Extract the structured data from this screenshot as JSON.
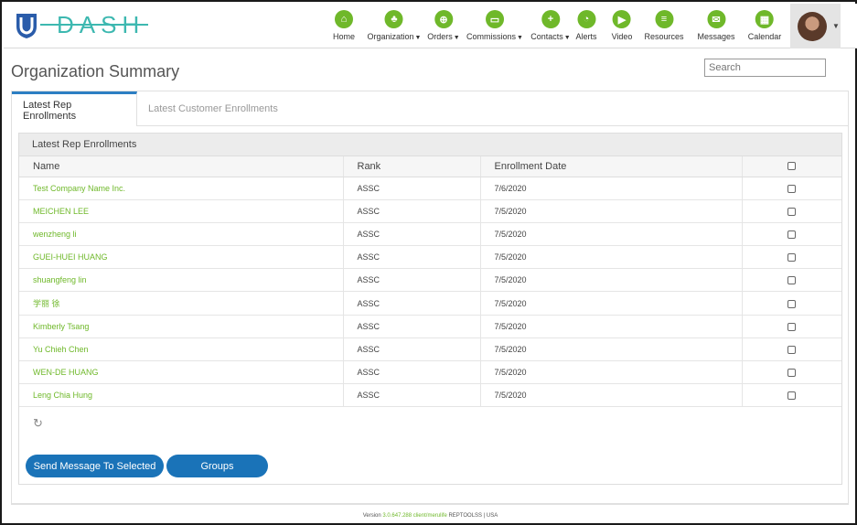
{
  "brand": {
    "logo_text": "DASH"
  },
  "nav": [
    {
      "label": "Home",
      "icon": "home-icon",
      "dropdown": false
    },
    {
      "label": "Organization",
      "icon": "organization-icon",
      "dropdown": true
    },
    {
      "label": "Orders",
      "icon": "cart-icon",
      "dropdown": true
    },
    {
      "label": "Commissions",
      "icon": "wallet-icon",
      "dropdown": true
    },
    {
      "label": "Contacts",
      "icon": "add-contact-icon",
      "dropdown": true
    },
    {
      "label": "Alerts",
      "icon": "bell-icon",
      "dropdown": false
    },
    {
      "label": "Video",
      "icon": "video-icon",
      "dropdown": false
    },
    {
      "label": "Resources",
      "icon": "document-icon",
      "dropdown": false
    },
    {
      "label": "Messages",
      "icon": "envelope-icon",
      "dropdown": false
    },
    {
      "label": "Calendar",
      "icon": "calendar-icon",
      "dropdown": false
    }
  ],
  "page": {
    "title": "Organization Summary",
    "search_placeholder": "Search"
  },
  "tabs": [
    {
      "label": "Latest Rep Enrollments",
      "active": true
    },
    {
      "label": "Latest Customer Enrollments",
      "active": false
    }
  ],
  "panel": {
    "heading": "Latest Rep Enrollments",
    "columns": [
      "Name",
      "Rank",
      "Enrollment Date"
    ],
    "rows": [
      {
        "name": "Test Company Name Inc.",
        "rank": "ASSC",
        "date": "7/6/2020"
      },
      {
        "name": "MEICHEN LEE",
        "rank": "ASSC",
        "date": "7/5/2020"
      },
      {
        "name": "wenzheng li",
        "rank": "ASSC",
        "date": "7/5/2020"
      },
      {
        "name": "GUEI-HUEI HUANG",
        "rank": "ASSC",
        "date": "7/5/2020"
      },
      {
        "name": "shuangfeng lin",
        "rank": "ASSC",
        "date": "7/5/2020"
      },
      {
        "name": "学丽 徐",
        "rank": "ASSC",
        "date": "7/5/2020"
      },
      {
        "name": "Kimberly Tsang",
        "rank": "ASSC",
        "date": "7/5/2020"
      },
      {
        "name": "Yu Chieh Chen",
        "rank": "ASSC",
        "date": "7/5/2020"
      },
      {
        "name": "WEN-DE HUANG",
        "rank": "ASSC",
        "date": "7/5/2020"
      },
      {
        "name": "Leng Chia Hung",
        "rank": "ASSC",
        "date": "7/5/2020"
      }
    ],
    "send_button": "Send Message To Selected",
    "groups_button": "Groups"
  },
  "footer": {
    "prefix": "Version",
    "version_link": "3.0.647.288 client/merulife",
    "suffix": "REPTOOLSS | USA"
  },
  "colors": {
    "accent_green": "#6fb82a",
    "brand_teal": "#3db8b0",
    "button_blue": "#1a73b8",
    "tab_blue": "#2c7fc3"
  }
}
